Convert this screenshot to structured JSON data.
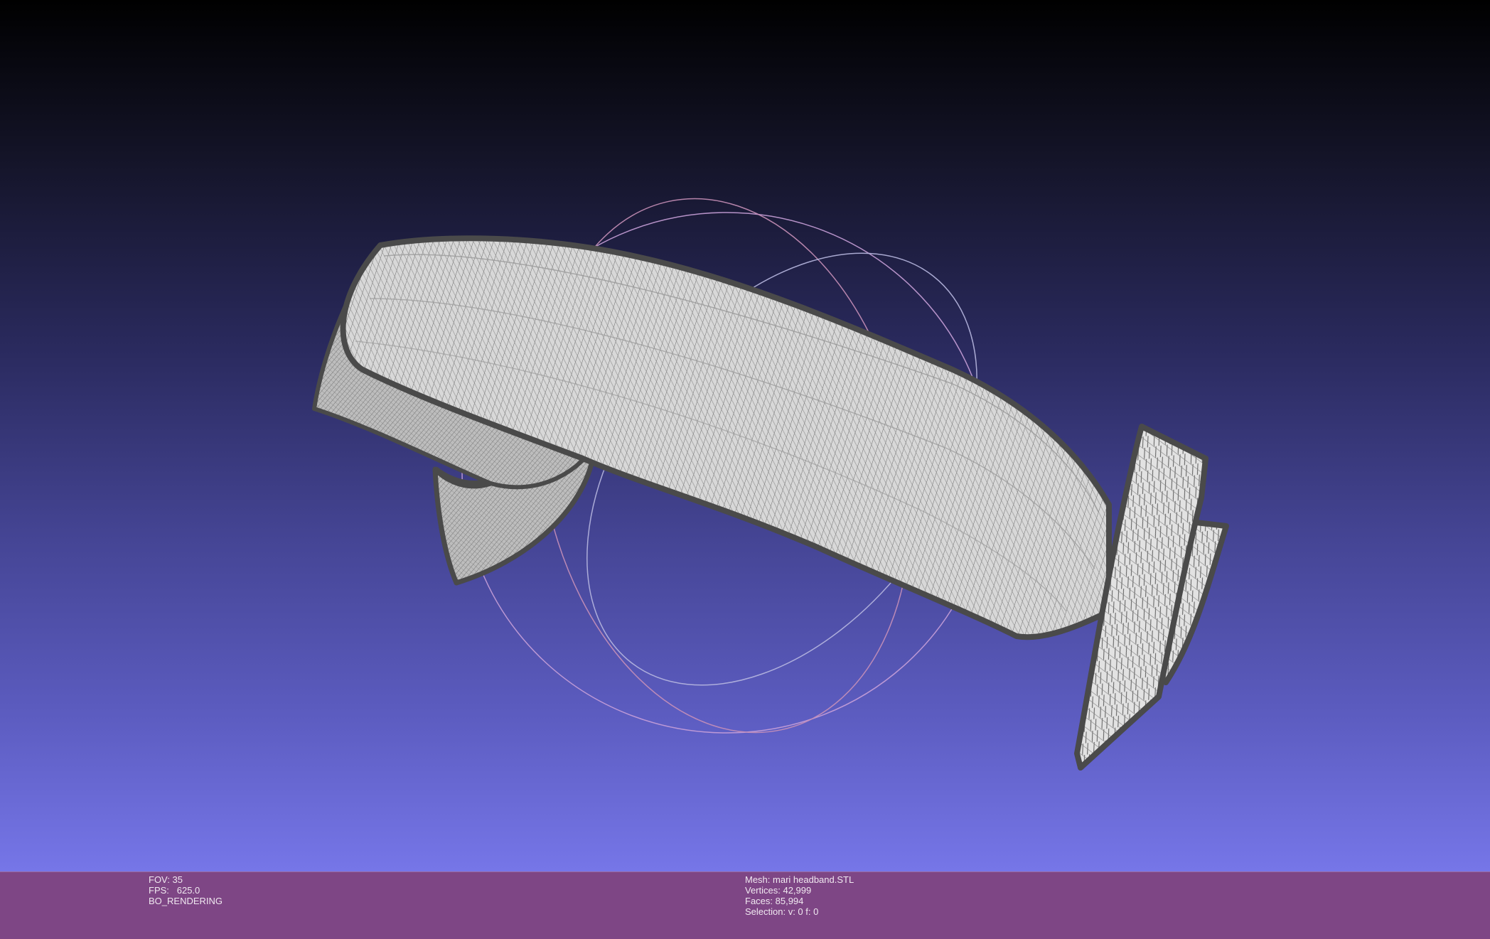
{
  "viewport": {
    "background_top": "#000000",
    "background_bottom": "#7676e8",
    "model_color": "#d4d4d4",
    "edge_color": "#4a4a4a",
    "trackball_colors": [
      "#c890c8",
      "#b8b0e0"
    ]
  },
  "info": {
    "fov": "FOV: 35",
    "fps": "FPS:   625.0",
    "render_mode": "BO_RENDERING",
    "mesh": "Mesh: mari headband.STL",
    "vertices": "Vertices: 42,999",
    "faces": "Faces: 85,994",
    "selection": "Selection: v: 0 f: 0"
  },
  "info_bar": {
    "background": "#7e4685"
  }
}
